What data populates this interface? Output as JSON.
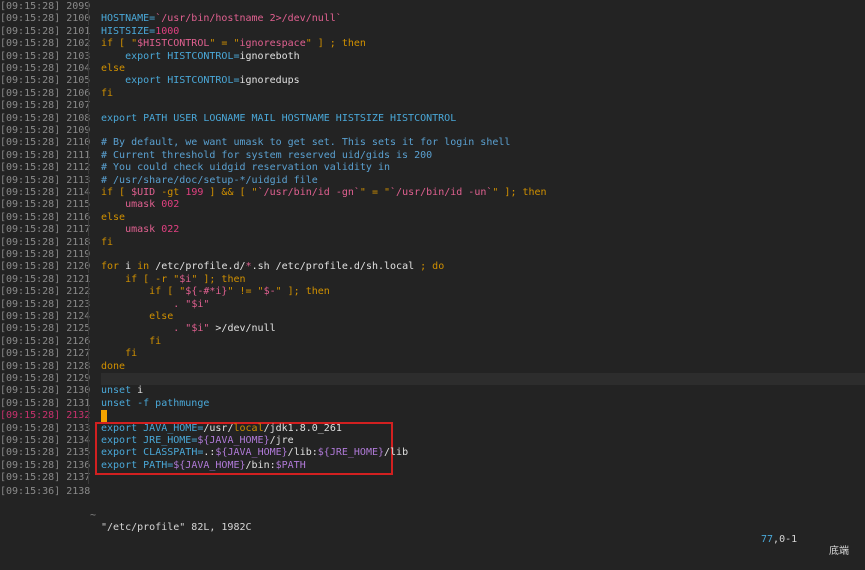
{
  "gutter": [
    "[09:15:28] 2099",
    "[09:15:28] 2100",
    "[09:15:28] 2101",
    "[09:15:28] 2102",
    "[09:15:28] 2103",
    "[09:15:28] 2104",
    "[09:15:28] 2105",
    "[09:15:28] 2106",
    "[09:15:28] 2107",
    "[09:15:28] 2108",
    "[09:15:28] 2109",
    "[09:15:28] 2110",
    "[09:15:28] 2111",
    "[09:15:28] 2112",
    "[09:15:28] 2113",
    "[09:15:28] 2114",
    "[09:15:28] 2115",
    "[09:15:28] 2116",
    "[09:15:28] 2117",
    "[09:15:28] 2118",
    "[09:15:28] 2119",
    "[09:15:28] 2120",
    "[09:15:28] 2121",
    "[09:15:28] 2122",
    "[09:15:28] 2123",
    "[09:15:28] 2124",
    "[09:15:28] 2125",
    "[09:15:28] 2126",
    "[09:15:28] 2127",
    "[09:15:28] 2128",
    "[09:15:28] 2129",
    "[09:15:28] 2130",
    "[09:15:28] 2131",
    "[09:15:28] 2132",
    "[09:15:28] 2133",
    "[09:15:28] 2134",
    "[09:15:28] 2135",
    "[09:15:28] 2136",
    "[09:15:28] 2137",
    "[09:15:36] 2138"
  ],
  "lines": [
    [],
    [
      [
        "HOSTNAME=",
        "id"
      ],
      [
        "`/usr/bin/hostname 2>/dev/null`",
        "str"
      ]
    ],
    [
      [
        "HISTSIZE=",
        "id"
      ],
      [
        "1000",
        "num"
      ]
    ],
    [
      [
        "if [ \"",
        "kw"
      ],
      [
        "$HISTCONTROL",
        "str"
      ],
      [
        "\" = \"",
        "kw"
      ],
      [
        "ignorespace",
        "str"
      ],
      [
        "\" ] ; then",
        "kw"
      ]
    ],
    [
      [
        "    export ",
        "id"
      ],
      [
        "HISTCONTROL=",
        "id"
      ],
      [
        "ignoreboth",
        "wh"
      ]
    ],
    [
      [
        "else",
        "kw"
      ]
    ],
    [
      [
        "    export ",
        "id"
      ],
      [
        "HISTCONTROL=",
        "id"
      ],
      [
        "ignoredups",
        "wh"
      ]
    ],
    [
      [
        "fi",
        "kw"
      ]
    ],
    [],
    [
      [
        "export PATH USER LOGNAME MAIL HOSTNAME HISTSIZE HISTCONTROL",
        "id"
      ]
    ],
    [],
    [
      [
        "# By default, we want umask to get set. This sets it for login shell",
        "cm"
      ]
    ],
    [
      [
        "# Current threshold for system reserved uid/gids is 200",
        "cm"
      ]
    ],
    [
      [
        "# You could check uidgid reservation validity in",
        "cm"
      ]
    ],
    [
      [
        "# /usr/share/doc/setup-*/uidgid file",
        "cm"
      ]
    ],
    [
      [
        "if [ ",
        "kw"
      ],
      [
        "$UID",
        "str"
      ],
      [
        " -gt ",
        "kw"
      ],
      [
        "199",
        "num"
      ],
      [
        " ] && [ \"",
        "kw"
      ],
      [
        "`/usr/bin/id -gn`",
        "str"
      ],
      [
        "\" = \"",
        "kw"
      ],
      [
        "`/usr/bin/id -un`",
        "str"
      ],
      [
        "\" ]; then",
        "kw"
      ]
    ],
    [
      [
        "    umask ",
        "str"
      ],
      [
        "002",
        "num"
      ]
    ],
    [
      [
        "else",
        "kw"
      ]
    ],
    [
      [
        "    umask ",
        "str"
      ],
      [
        "022",
        "num"
      ]
    ],
    [
      [
        "fi",
        "kw"
      ]
    ],
    [],
    [
      [
        "for ",
        "kw"
      ],
      [
        "i",
        "wh"
      ],
      [
        " in ",
        "kw"
      ],
      [
        "/etc/profile.d/",
        "wh"
      ],
      [
        "*",
        "str"
      ],
      [
        ".sh /etc/profile.d/sh.local ",
        "wh"
      ],
      [
        "; do",
        "kw"
      ]
    ],
    [
      [
        "    if [ -r \"",
        "kw"
      ],
      [
        "$i",
        "str"
      ],
      [
        "\" ]; then",
        "kw"
      ]
    ],
    [
      [
        "        if [ \"",
        "kw"
      ],
      [
        "${-#*i}",
        "str"
      ],
      [
        "\" != \"",
        "kw"
      ],
      [
        "$-",
        "str"
      ],
      [
        "\" ]; then",
        "kw"
      ]
    ],
    [
      [
        "            . \"",
        "str"
      ],
      [
        "$i",
        "str"
      ],
      [
        "\"",
        "str"
      ]
    ],
    [
      [
        "        else",
        "kw"
      ]
    ],
    [
      [
        "            . \"",
        "str"
      ],
      [
        "$i",
        "str"
      ],
      [
        "\" ",
        "str"
      ],
      [
        ">/dev/null",
        "wh"
      ]
    ],
    [
      [
        "        fi",
        "kw"
      ]
    ],
    [
      [
        "    fi",
        "kw"
      ]
    ],
    [
      [
        "done",
        "kw"
      ]
    ],
    [],
    [
      [
        "unset ",
        "id"
      ],
      [
        "i",
        "wh"
      ]
    ],
    [
      [
        "unset -f pathmunge",
        "id"
      ]
    ],
    [],
    [
      [
        "export ",
        "id"
      ],
      [
        "JAVA_HOME=",
        "id"
      ],
      [
        "/usr/",
        "wh"
      ],
      [
        "local",
        "kw"
      ],
      [
        "/jdk1.8.0_261",
        "wh"
      ]
    ],
    [
      [
        "export ",
        "id"
      ],
      [
        "JRE_HOME=",
        "id"
      ],
      [
        "${JAVA_HOME}",
        "var"
      ],
      [
        "/jre",
        "wh"
      ]
    ],
    [
      [
        "export ",
        "id"
      ],
      [
        "CLASSPATH=",
        "id"
      ],
      [
        ".:",
        "wh"
      ],
      [
        "${JAVA_HOME}",
        "var"
      ],
      [
        "/lib:",
        "wh"
      ],
      [
        "${JRE_HOME}",
        "var"
      ],
      [
        "/lib",
        "wh"
      ]
    ],
    [
      [
        "export ",
        "id"
      ],
      [
        "PATH=",
        "id"
      ],
      [
        "${JAVA_HOME}",
        "var"
      ],
      [
        "/bin:",
        "wh"
      ],
      [
        "$PATH",
        "var"
      ]
    ],
    []
  ],
  "current_line_index": 33,
  "highlight_line_index": 30,
  "status": {
    "tilde": "~",
    "message": "\"/etc/profile\" 82L, 1982C",
    "position_num": "77",
    "position_rest": ",0-1",
    "scroll": "底端"
  },
  "colors": {
    "background": "#232323",
    "current_line_number": "#c8326e",
    "cursor": "#f5a400",
    "annotation_box": "#d22020"
  }
}
